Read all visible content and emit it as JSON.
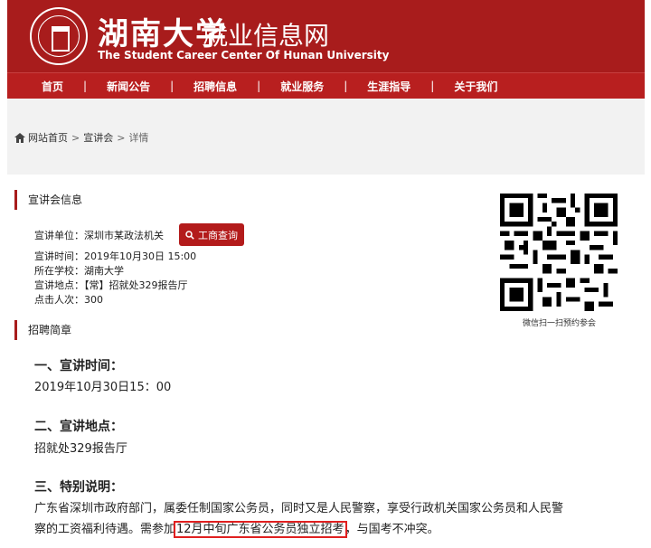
{
  "header": {
    "logo_cn": "湖南大学",
    "site_name": "就业信息网",
    "subtitle_en": "The Student Career Center Of Hunan University"
  },
  "nav": {
    "items": [
      {
        "label": "首页"
      },
      {
        "label": "新闻公告"
      },
      {
        "label": "招聘信息"
      },
      {
        "label": "就业服务"
      },
      {
        "label": "生涯指导"
      },
      {
        "label": "关于我们"
      }
    ],
    "separator": "|"
  },
  "breadcrumb": {
    "home": "网站首页",
    "level1": "宣讲会",
    "current": "详情",
    "sep": ">"
  },
  "info_section": {
    "title": "宣讲会信息",
    "unit": "宣讲单位：深圳市某政法机关",
    "time": "宣讲时间：2019年10月30日 15:00",
    "school": "所在学校：湖南大学",
    "location": "宣讲地点：【常】招就处329报告厅",
    "clicks": "点击人次：300",
    "business_button": "工商查询",
    "qr_caption": "微信扫一扫预约参会"
  },
  "brief_section": {
    "title": "招聘简章",
    "h1": "一、宣讲时间：",
    "p1": "2019年10月30日15：00",
    "h2": "二、宣讲地点：",
    "p2": "招就处329报告厅",
    "h3": "三、特别说明：",
    "p3_line1": "广东省深圳市政府部门，属委任制国家公务员，同时又是人民警察，享受行政机关国家公务员和人民警",
    "p3_line2_a": "察的工资福利待遇。需参加",
    "p3_line2_highlight": "12月中旬广东省公务员独立招考",
    "p3_line2_b": "，与国考不冲突。"
  },
  "colors": {
    "brand_red": "#a81c1c",
    "nav_red": "#b81f1f",
    "highlight_border": "#e02020"
  }
}
